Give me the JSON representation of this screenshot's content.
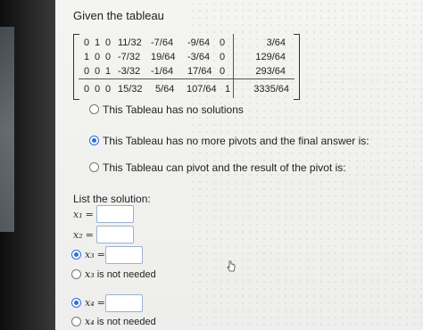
{
  "question": {
    "title": "Given the tableau"
  },
  "tableau": {
    "rows": [
      {
        "cells": [
          "0",
          "1",
          "0",
          "11/32",
          "-7/64",
          "-9/64",
          "0"
        ],
        "rhs": "3/64"
      },
      {
        "cells": [
          "1",
          "0",
          "0",
          "-7/32",
          "19/64",
          "-3/64",
          "0"
        ],
        "rhs": "129/64"
      },
      {
        "cells": [
          "0",
          "0",
          "1",
          "-3/32",
          "-1/64",
          "17/64",
          "0"
        ],
        "rhs": "293/64"
      },
      {
        "cells": [
          "0",
          "0",
          "0",
          "15/32",
          "5/64",
          "107/64",
          "1"
        ],
        "rhs": "3335/64"
      }
    ]
  },
  "options": [
    {
      "label": "This Tableau has no solutions",
      "selected": false
    },
    {
      "label": "This Tableau has no more pivots and the final answer is:",
      "selected": true
    },
    {
      "label": "This Tableau can pivot and the result of the pivot is:",
      "selected": false
    }
  ],
  "solution": {
    "title": "List the solution:",
    "vars": [
      {
        "name": "x₁",
        "value": ""
      },
      {
        "name": "x₂",
        "value": ""
      },
      {
        "name": "x₃",
        "value": "",
        "selected": true
      },
      {
        "name": "x₄",
        "value": "",
        "selected": true
      }
    ],
    "not_needed": [
      {
        "var": "x₃",
        "text": "is not needed"
      },
      {
        "var": "x₄",
        "text": "is not needed"
      }
    ]
  },
  "colors": {
    "accent": "#2e6fd8",
    "input_border": "#9bb2d1"
  },
  "icons": {
    "cursor": "hand-pointer-icon",
    "radio": "radio-button-icon"
  }
}
